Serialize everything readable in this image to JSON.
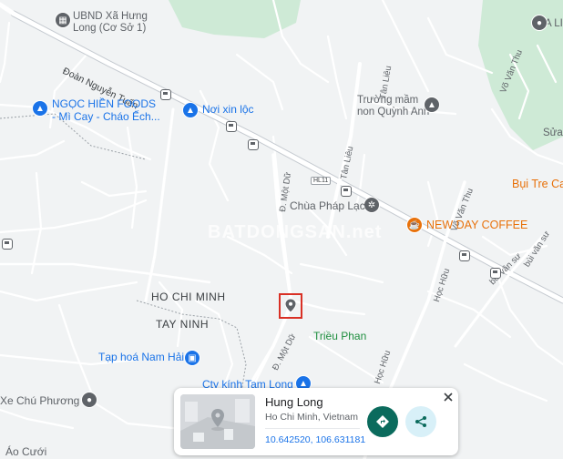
{
  "labels": {
    "ubnd": "UBND Xã Hưng\nLong (Cơ Sở 1)",
    "doan_nguyen_tuan": "Đoàn Nguyễn Tuấn",
    "ngoc_hien": "NGỌC HIỀN FOODS\n- Mì Cay - Cháo Ếch...",
    "noi_xin_loc": "Nơi xin lộc",
    "tan_lieu_1": "Tân Liêu",
    "tan_lieu_2": "Tân Liêu",
    "truong_mam_non": "Trường mầm\nnon Quỳnh Anh",
    "vo_van_thu_1": "Võ Văn Thu",
    "vo_van_thu_2": "Võ Văn Thu",
    "sua": "Sửa",
    "a_li": "A LI",
    "bui_tre": "Bụi Tre Cafe",
    "new_day": "NEW DAY COFFEE",
    "chua_phap_lac": "Chùa Pháp Lạc",
    "mot_du_1": "Đ. Một Dữ",
    "mot_du_2": "Đ. Một Dữ",
    "hl11": "HL11",
    "hoc_huu_1": "Học Hữu",
    "hoc_huu_2": "Học Hữu",
    "bui_van_su_1": "bùi văn sư",
    "bui_van_su_2": "bùi văn sư",
    "ho_chi_minh": "HO CHI MINH",
    "tay_ninh": "TAY NINH",
    "trieu_phan": "Triều Phan",
    "tap_hoa": "Tạp hoá Nam Hải",
    "cty_kinh": "Cty kính Tam Long",
    "xe_chu_phuong": "Xe Chú Phương",
    "ao_cuoi": "Áo Cưới",
    "watermark": "BATDONGSAN.net"
  },
  "card": {
    "name": "Hung Long",
    "address": "Ho Chi Minh, Vietnam",
    "coordinates": "10.642520, 106.631181"
  },
  "colors": {
    "map_bg": "#f1f3f4",
    "park": "#ceead6",
    "road": "#ffffff",
    "poi_blue": "#1a73e8",
    "highlight": "#d93025",
    "directions_btn": "#0b6b5d",
    "share_btn": "#d8f0f8"
  },
  "icons": {
    "directions": "directions-icon",
    "share": "share-icon",
    "close": "close-icon",
    "marker": "location-pin-icon"
  }
}
